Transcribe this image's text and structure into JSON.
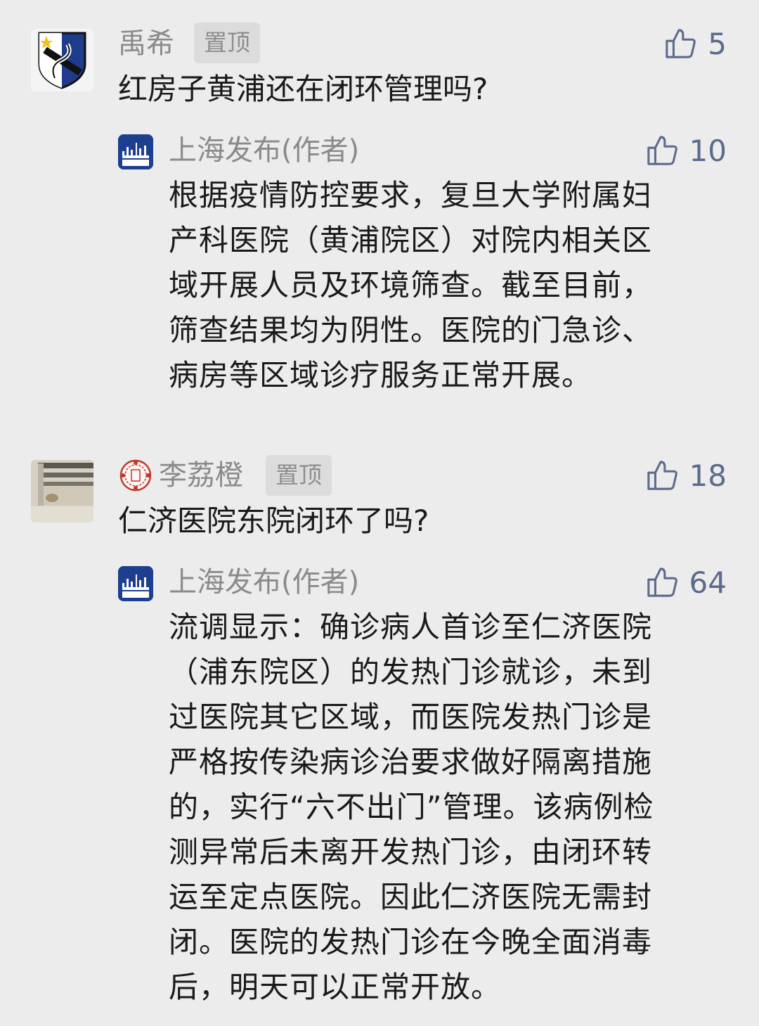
{
  "comments": [
    {
      "user": "禹希",
      "pinned_label": "置顶",
      "likes": "5",
      "text": "红房子黄浦还在闭环管理吗?",
      "reply": {
        "author": "上海发布(作者)",
        "likes": "10",
        "lines": [
          "根据疫情防控要求，复旦大学附属妇",
          "产科医院（黄浦院区）对院内相关区",
          "域开展人员及环境筛查。截至目前，",
          "筛查结果均为阴性。医院的门急诊、",
          "病房等区域诊疗服务正常开展。"
        ]
      }
    },
    {
      "user": "李荔橙",
      "pinned_label": "置顶",
      "likes": "18",
      "text": "仁济医院东院闭环了吗?",
      "reply": {
        "author": "上海发布(作者)",
        "likes": "64",
        "lines": [
          "流调显示：确诊病人首诊至仁济医院",
          "（浦东院区）的发热门诊就诊，未到",
          "过医院其它区域，而医院发热门诊是",
          "严格按传染病诊治要求做好隔离措施",
          "的，实行“六不出门”管理。该病例检",
          "测异常后未离开发热门诊，由闭环转",
          "运至定点医院。因此仁济医院无需封",
          "闭。医院的发热门诊在今晚全面消毒",
          "后，明天可以正常开放。"
        ]
      }
    }
  ],
  "icons": {
    "like": "thumbs-up-icon",
    "reply_avatar": "shanghai-fabu-logo-icon"
  },
  "colors": {
    "background": "#ececec",
    "name": "#8a8a8a",
    "like": "#5a6b8c",
    "pin_bg": "#dcdcdc",
    "logo_blue": "#1e3f8f"
  }
}
